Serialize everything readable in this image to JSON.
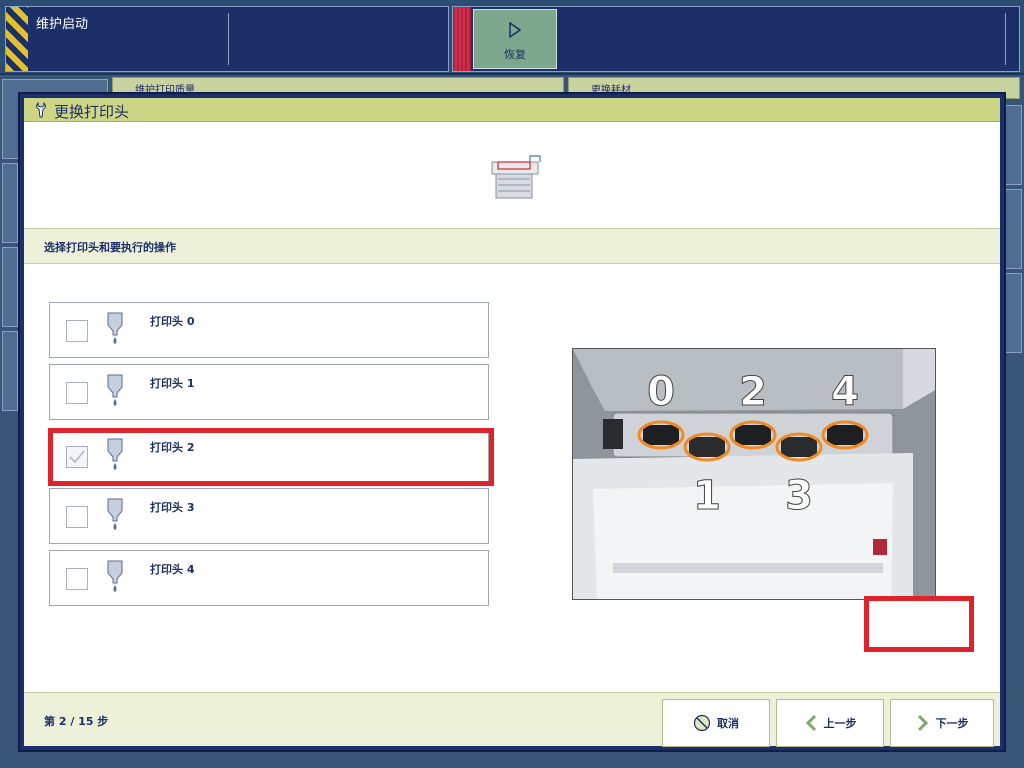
{
  "topbar": {
    "status_text": "维护启动",
    "resume_label": "恢复"
  },
  "background": {
    "tab_left": "维护打印质量",
    "tab_right": "更换耗材"
  },
  "dialog": {
    "title": "更换打印头",
    "instruction": "选择打印头和要执行的操作",
    "printheads": [
      {
        "label": "打印头 0",
        "checked": false
      },
      {
        "label": "打印头 1",
        "checked": false
      },
      {
        "label": "打印头 2",
        "checked": true
      },
      {
        "label": "打印头 3",
        "checked": false
      },
      {
        "label": "打印头 4",
        "checked": false
      }
    ],
    "photo_numbers_top": [
      "0",
      "2",
      "4"
    ],
    "photo_numbers_bottom": [
      "1",
      "3"
    ]
  },
  "footer": {
    "step": "第 2 / 15 步",
    "cancel": "取消",
    "previous": "上一步",
    "next": "下一步"
  },
  "colors": {
    "highlight": "#e0222a",
    "header_bar": "#cdd684",
    "navy": "#1d2f68",
    "ring": "#f08a24"
  }
}
